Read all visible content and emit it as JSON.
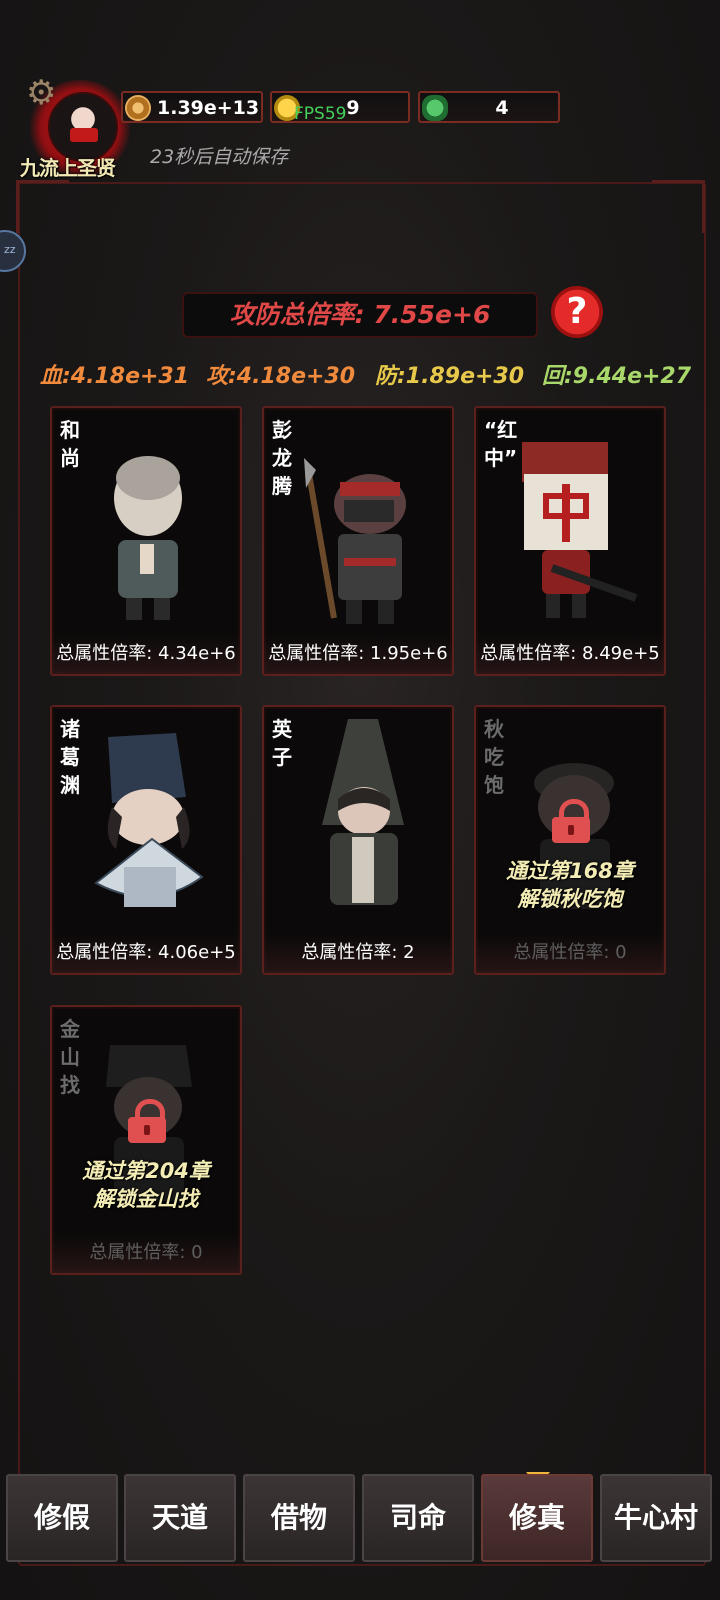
{
  "header": {
    "rank_title": "九流上圣贤",
    "autosave_text": "23秒后自动保存",
    "resources": [
      {
        "icon": "copper-coin-icon",
        "value": "1.39e+13"
      },
      {
        "icon": "gold-ingot-icon",
        "value": "9"
      },
      {
        "icon": "jade-icon",
        "value": "4"
      }
    ],
    "fps_label": "FPS59"
  },
  "summary": {
    "multiplier_label": "攻防总倍率: 7.55e+6",
    "help_label": "?",
    "stats": {
      "hp": "血:4.18e+31",
      "atk": "攻:4.18e+30",
      "def": "防:1.89e+30",
      "regen": "回:9.44e+27"
    }
  },
  "characters": [
    {
      "name": "和尚",
      "footer": "总属性倍率: 4.34e+6",
      "locked": false
    },
    {
      "name": "彭龙腾",
      "footer": "总属性倍率: 1.95e+6",
      "locked": false
    },
    {
      "name": "“红中”",
      "footer": "总属性倍率: 8.49e+5",
      "locked": false
    },
    {
      "name": "诸葛渊",
      "footer": "总属性倍率: 4.06e+5",
      "locked": false
    },
    {
      "name": "英子",
      "footer": "总属性倍率: 2",
      "locked": false
    },
    {
      "name": "秋吃饱",
      "footer": "总属性倍率: 0",
      "locked": true,
      "unlock_line1": "通过第168章",
      "unlock_line2": "解锁秋吃饱"
    },
    {
      "name": "金山找",
      "footer": "总属性倍率: 0",
      "locked": true,
      "unlock_line1": "通过第204章",
      "unlock_line2": "解锁金山找"
    }
  ],
  "nav": {
    "tabs": [
      "修假",
      "天道",
      "借物",
      "司命",
      "修真",
      "牛心村"
    ],
    "active": "修真"
  },
  "colors": {
    "multiplier": "#e04848",
    "hp": "#f08a3c",
    "atk": "#f08a3c",
    "def": "#e6c84a",
    "regen": "#a9d86a",
    "active_caret": "#f0b53a"
  }
}
